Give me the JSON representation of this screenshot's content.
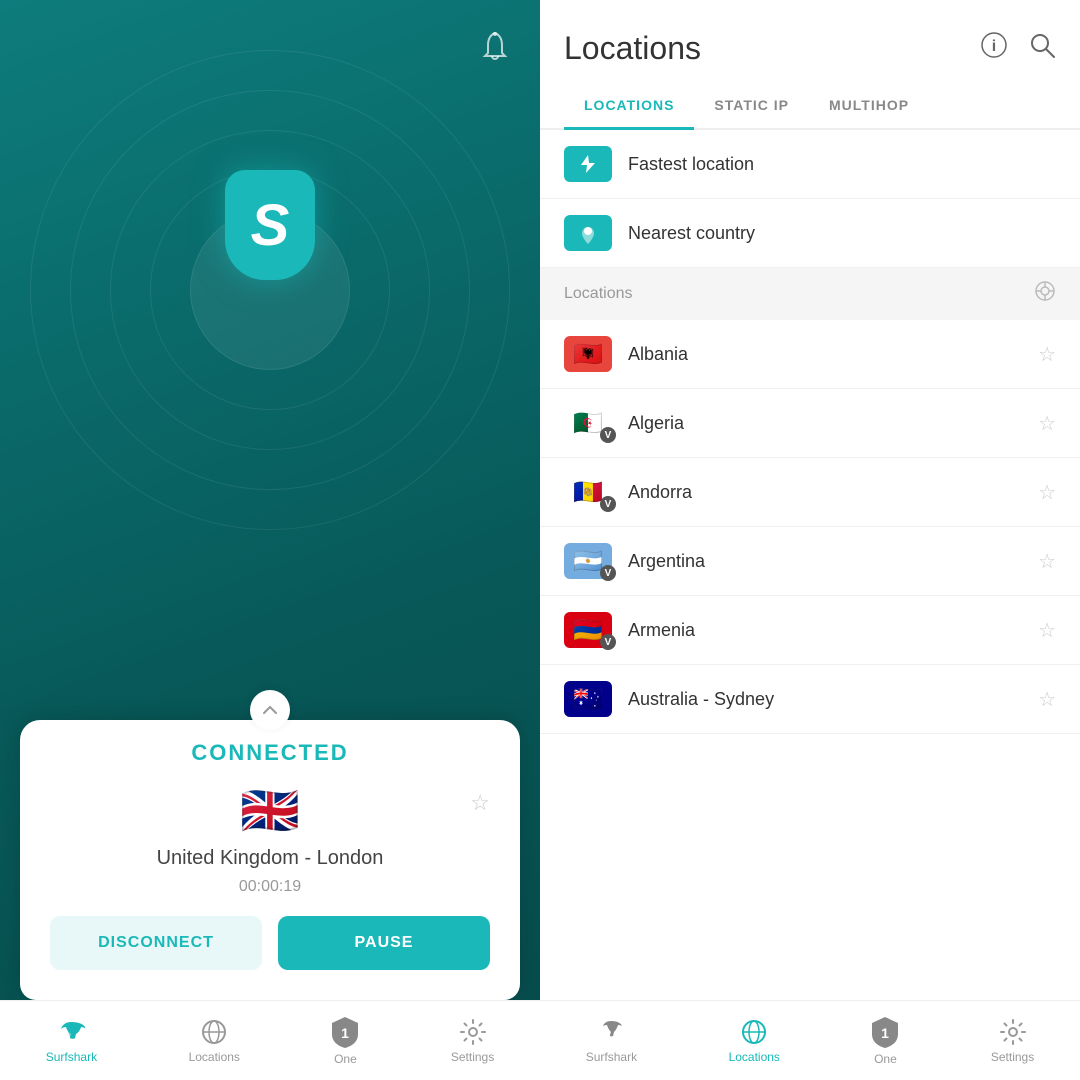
{
  "left": {
    "bell_label": "Bell",
    "connected_label": "CONNECTED",
    "flag": "🇬🇧",
    "location_name": "United Kingdom - London",
    "timer": "00:00:19",
    "disconnect_btn": "DISCONNECT",
    "pause_btn": "PAUSE",
    "nav": [
      {
        "id": "surfshark",
        "label": "Surfshark",
        "active": true
      },
      {
        "id": "locations",
        "label": "Locations",
        "active": false
      },
      {
        "id": "one",
        "label": "One",
        "active": false
      },
      {
        "id": "settings",
        "label": "Settings",
        "active": false
      }
    ]
  },
  "right": {
    "title": "Locations",
    "tabs": [
      {
        "id": "locations",
        "label": "LOCATIONS",
        "active": true
      },
      {
        "id": "static-ip",
        "label": "STATIC IP",
        "active": false
      },
      {
        "id": "multihop",
        "label": "MULTIHOP",
        "active": false
      }
    ],
    "quick_items": [
      {
        "id": "fastest",
        "label": "Fastest location",
        "icon": "⚡"
      },
      {
        "id": "nearest",
        "label": "Nearest country",
        "icon": "📍"
      }
    ],
    "section_label": "Locations",
    "countries": [
      {
        "id": "albania",
        "label": "Albania",
        "flag": "🇦🇱",
        "virtual": false
      },
      {
        "id": "algeria",
        "label": "Algeria",
        "flag": "🇩🇿",
        "virtual": true
      },
      {
        "id": "andorra",
        "label": "Andorra",
        "flag": "🇦🇩",
        "virtual": true
      },
      {
        "id": "argentina",
        "label": "Argentina",
        "flag": "🇦🇷",
        "virtual": true
      },
      {
        "id": "armenia",
        "label": "Armenia",
        "flag": "🇦🇲",
        "virtual": true
      },
      {
        "id": "australia-sydney",
        "label": "Australia - Sydney",
        "flag": "🇦🇺",
        "virtual": false
      }
    ],
    "nav": [
      {
        "id": "surfshark",
        "label": "Surfshark",
        "active": false
      },
      {
        "id": "locations",
        "label": "Locations",
        "active": true
      },
      {
        "id": "one",
        "label": "One",
        "active": false
      },
      {
        "id": "settings",
        "label": "Settings",
        "active": false
      }
    ]
  }
}
